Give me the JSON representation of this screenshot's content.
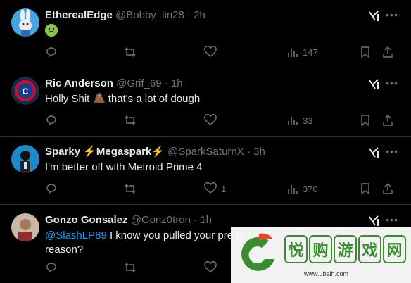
{
  "tweets": [
    {
      "name": "EtherealEdge",
      "handle": "@Bobby_lin28",
      "time": "2h",
      "text": "",
      "emoji": "nauseated-face",
      "views": "147",
      "likes": ""
    },
    {
      "name": "Ric Anderson",
      "handle": "@Grif_69",
      "time": "1h",
      "text_before": "Holly Shit",
      "text_after": "that's a lot of dough",
      "views": "33",
      "likes": ""
    },
    {
      "name_part1": "Sparky",
      "name_part2": "Megaspark",
      "handle": "@SparkSaturnX",
      "time": "3h",
      "text": "I'm better off with Metroid Prime 4",
      "likes": "1",
      "views": "370"
    },
    {
      "name": "Gonzo Gonsalez",
      "handle": "@Gonz0tron",
      "time": "1h",
      "mention": "@SlashLP89",
      "text_line1": " I know you pulled your pre o",
      "text_line2": "reason?",
      "likes": "",
      "views": ""
    }
  ],
  "separator": "·",
  "bolt_glyph": "⚡",
  "watermark": {
    "chars": [
      "悦",
      "购",
      "游",
      "戏",
      "网"
    ],
    "url": "www.ubalh.com"
  },
  "colors": {
    "background": "#000000",
    "text": "#e7e9ea",
    "muted": "#71767b",
    "link": "#1d9bf0",
    "divider": "#2f3336"
  }
}
